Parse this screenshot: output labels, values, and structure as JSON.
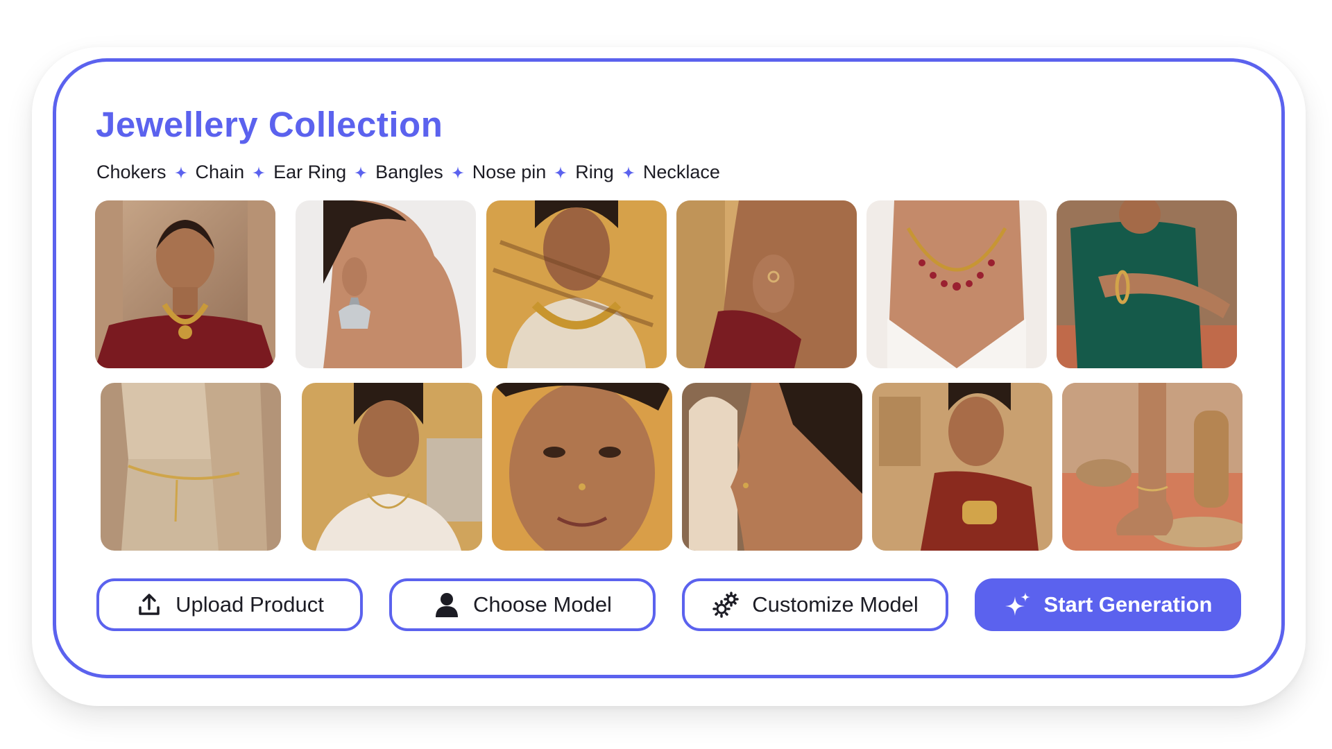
{
  "title": "Jewellery Collection",
  "categories": [
    "Chokers",
    "Chain",
    "Ear Ring",
    "Bangles",
    "Nose pin",
    "Ring",
    "Necklace"
  ],
  "separator_icon": "sparkle-icon",
  "accent_color": "#5b62ee",
  "gallery": [
    {
      "icon": "photo-model-choker-red-saree"
    },
    {
      "icon": "photo-model-silver-jhumka-earring"
    },
    {
      "icon": "photo-model-gold-choker-shadows"
    },
    {
      "icon": "photo-model-ring-hand"
    },
    {
      "icon": "photo-model-ruby-necklace"
    },
    {
      "icon": "photo-model-bangle-green-dress"
    },
    {
      "icon": "photo-model-waist-chain"
    },
    {
      "icon": "photo-model-gold-chain"
    },
    {
      "icon": "photo-model-nose-pin-smile"
    },
    {
      "icon": "photo-model-nose-pin-profile"
    },
    {
      "icon": "photo-model-bangles-saree"
    },
    {
      "icon": "photo-model-anklet"
    }
  ],
  "buttons": {
    "upload": {
      "label": "Upload Product",
      "icon": "upload-icon"
    },
    "choose_model": {
      "label": "Choose Model",
      "icon": "person-icon"
    },
    "customize_model": {
      "label": "Customize Model",
      "icon": "gears-icon"
    },
    "start_generation": {
      "label": "Start Generation",
      "icon": "sparkles-icon"
    }
  }
}
